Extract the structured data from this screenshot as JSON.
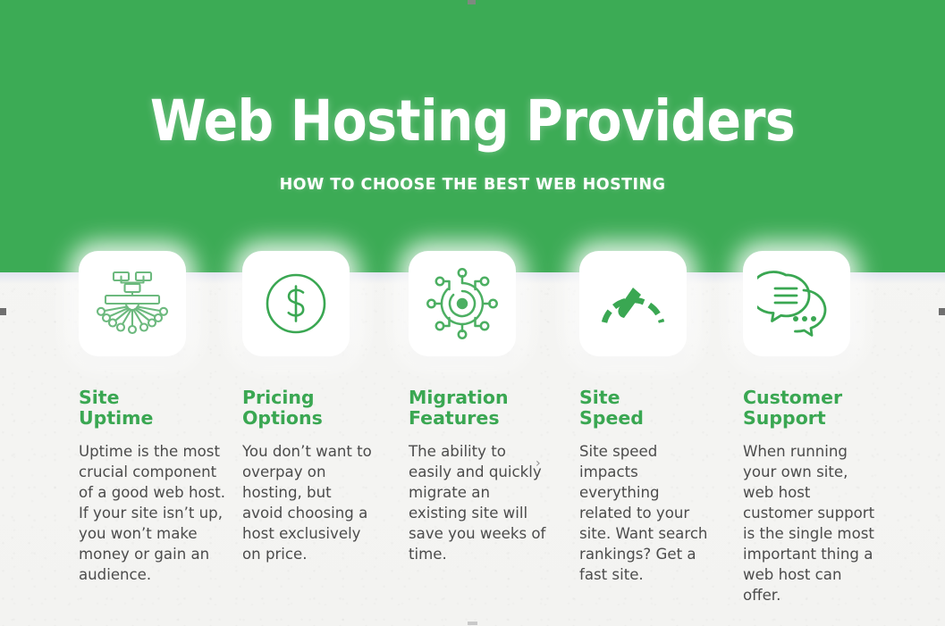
{
  "hero": {
    "title": "Web Hosting Providers",
    "subtitle": "HOW TO CHOOSE THE BEST WEB HOSTING",
    "background_color": "#3cab55",
    "text_color": "#ffffff"
  },
  "theme": {
    "green": "#3aa752",
    "banner_green": "#3cab55",
    "body_text": "#4c4c4c",
    "page_background": "#f4f4f2",
    "card_background": "#ffffff"
  },
  "columns": [
    {
      "icon": "network-distribution-icon",
      "heading": "Site\nUptime",
      "body": "Uptime is the most crucial component of a good web host. If your site isn’t up, you won’t make money or gain an audience."
    },
    {
      "icon": "dollar-circle-icon",
      "heading": "Pricing\nOptions",
      "body": "You don’t want to overpay on hosting, but avoid choosing a host exclusively on price."
    },
    {
      "icon": "network-hub-icon",
      "heading": "Migration\nFeatures",
      "body": "The ability to easily and quickly migrate an existing site will save you weeks of time."
    },
    {
      "icon": "speedometer-icon",
      "heading": "Site\nSpeed",
      "body": "Site speed impacts everything related to your site. Want search rankings? Get a fast site."
    },
    {
      "icon": "chat-bubbles-icon",
      "heading": "Customer\nSupport",
      "body": "When running your own site, web host customer support is the single most important thing a web host can offer."
    }
  ],
  "artifacts": {
    "stray_glyph": "›"
  }
}
